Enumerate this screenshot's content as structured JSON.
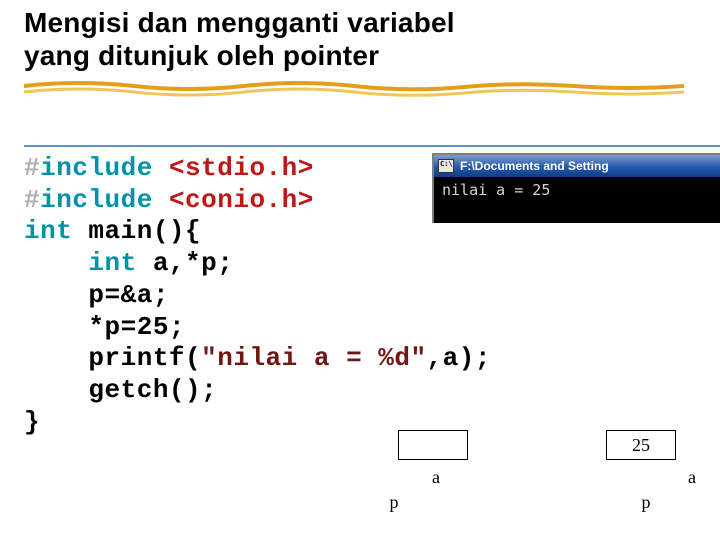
{
  "title_line1": "Mengisi dan mengganti variabel",
  "title_line2": "yang ditunjuk oleh pointer",
  "code": {
    "hash1": "#",
    "inc1": "include ",
    "hdr1": "<stdio.h>",
    "hash2": "#",
    "inc2": "include ",
    "hdr2": "<conio.h>",
    "kw_int": "int",
    "main_sig": " main(){",
    "kw_int2": "    int",
    "decl": " a,*p;",
    "l_assign1": "    p=&a;",
    "l_assign2": "    *p=25;",
    "printf_pre": "    printf(",
    "printf_str": "\"nilai a = %d\"",
    "printf_post": ",a);",
    "l_getch": "    getch();",
    "l_close": "}"
  },
  "console": {
    "title": "F:\\Documents and Setting",
    "output": "nilai a = 25"
  },
  "diagram": {
    "box1_value": "",
    "box2_value": "25",
    "label_a": "a",
    "label_p": "p"
  }
}
